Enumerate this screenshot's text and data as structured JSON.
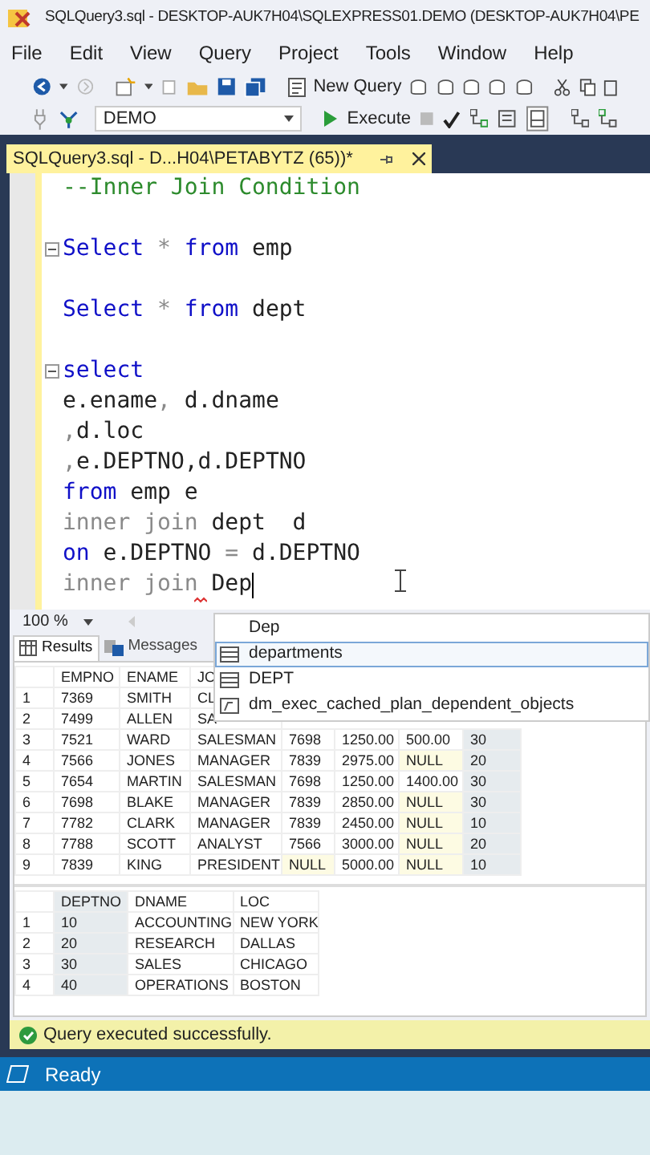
{
  "window": {
    "title": "SQLQuery3.sql - DESKTOP-AUK7H04\\SQLEXPRESS01.DEMO (DESKTOP-AUK7H04\\PE"
  },
  "menu": [
    "File",
    "Edit",
    "View",
    "Query",
    "Project",
    "Tools",
    "Window",
    "Help"
  ],
  "toolbar": {
    "new_query": "New Query",
    "database": "DEMO",
    "execute": "Execute"
  },
  "document_tab": {
    "title": "SQLQuery3.sql - D...H04\\PETABYTZ (65))*",
    "selected": true
  },
  "editor": {
    "lines": [
      {
        "fold": false,
        "tokens": [
          {
            "text": "--Inner Join Condition",
            "kind": "comment"
          }
        ]
      },
      {
        "fold": false
      },
      {
        "fold": true,
        "tokens": [
          {
            "text": "Select",
            "kind": "keyword"
          },
          {
            "text": " * ",
            "kind": "operator"
          },
          {
            "text": "from",
            "kind": "keyword"
          },
          {
            "text": " emp",
            "kind": "plain"
          }
        ]
      },
      {
        "fold": false
      },
      {
        "fold": false,
        "tokens": [
          {
            "text": "Select",
            "kind": "keyword"
          },
          {
            "text": " * ",
            "kind": "operator"
          },
          {
            "text": "from",
            "kind": "keyword"
          },
          {
            "text": " dept",
            "kind": "plain"
          }
        ]
      },
      {
        "fold": false
      },
      {
        "fold": true,
        "tokens": [
          {
            "text": "select",
            "kind": "keyword"
          }
        ]
      },
      {
        "fold": false,
        "tokens": [
          {
            "text": "e.ename",
            "kind": "plain"
          },
          {
            "text": ",",
            "kind": "operator"
          },
          {
            "text": " d.dname",
            "kind": "plain"
          }
        ]
      },
      {
        "fold": false,
        "tokens": [
          {
            "text": ",",
            "kind": "operator"
          },
          {
            "text": "d.loc",
            "kind": "plain"
          }
        ]
      },
      {
        "fold": false,
        "tokens": [
          {
            "text": ",",
            "kind": "operator"
          },
          {
            "text": "e.DEPTNO,d.DEPTNO",
            "kind": "plain"
          }
        ]
      },
      {
        "fold": false,
        "tokens": [
          {
            "text": "from",
            "kind": "keyword"
          },
          {
            "text": " emp e",
            "kind": "plain"
          }
        ]
      },
      {
        "fold": false,
        "tokens": [
          {
            "text": "inner join",
            "kind": "operator"
          },
          {
            "text": " dept  d",
            "kind": "plain"
          }
        ]
      },
      {
        "fold": false,
        "tokens": [
          {
            "text": "on",
            "kind": "keyword"
          },
          {
            "text": " e.DEPTNO ",
            "kind": "plain"
          },
          {
            "text": "=",
            "kind": "operator"
          },
          {
            "text": " d.DEPTNO",
            "kind": "plain"
          }
        ]
      },
      {
        "fold": false,
        "caret": true,
        "tokens": [
          {
            "text": "inner join",
            "kind": "operator"
          },
          {
            "text": " Dep",
            "kind": "plain"
          }
        ]
      }
    ]
  },
  "autocomplete": [
    {
      "text": "Dep",
      "kind": "typed",
      "selected": false
    },
    {
      "text": "departments",
      "kind": "table",
      "selected": true
    },
    {
      "text": "DEPT",
      "kind": "table",
      "selected": false
    },
    {
      "text": "dm_exec_cached_plan_dependent_objects",
      "kind": "function",
      "selected": false
    }
  ],
  "zoom": "100 %",
  "results_tabs": [
    {
      "label": "Results",
      "kind": "grid",
      "selected": true
    },
    {
      "label": "Messages",
      "kind": "messages",
      "selected": false
    }
  ],
  "grids": [
    {
      "columns": [
        {
          "label": "EMPNO",
          "selected": false
        },
        {
          "label": "ENAME",
          "selected": false
        },
        {
          "label": "JO",
          "selected": false
        },
        {
          "selected": false
        },
        {
          "selected": false
        },
        {
          "selected": false
        },
        {
          "selected": true
        }
      ],
      "rows": [
        {
          "number": "1",
          "cells": [
            "7369",
            "SMITH",
            "CL"
          ]
        },
        {
          "number": "2",
          "cells": [
            "7499",
            "ALLEN",
            "SA"
          ]
        },
        {
          "number": "3",
          "cells": [
            "7521",
            "WARD",
            "SALESMAN",
            "7698",
            "1250.00",
            "500.00",
            "30"
          ]
        },
        {
          "number": "4",
          "cells": [
            "7566",
            "JONES",
            "MANAGER",
            "7839",
            "2975.00",
            {
              "text": "NULL",
              "kind": "null"
            },
            "20"
          ]
        },
        {
          "number": "5",
          "cells": [
            "7654",
            "MARTIN",
            "SALESMAN",
            "7698",
            "1250.00",
            "1400.00",
            "30"
          ]
        },
        {
          "number": "6",
          "cells": [
            "7698",
            "BLAKE",
            "MANAGER",
            "7839",
            "2850.00",
            {
              "text": "NULL",
              "kind": "null"
            },
            "30"
          ]
        },
        {
          "number": "7",
          "cells": [
            "7782",
            "CLARK",
            "MANAGER",
            "7839",
            "2450.00",
            {
              "text": "NULL",
              "kind": "null"
            },
            "10"
          ]
        },
        {
          "number": "8",
          "cells": [
            "7788",
            "SCOTT",
            "ANALYST",
            "7566",
            "3000.00",
            {
              "text": "NULL",
              "kind": "null"
            },
            "20"
          ]
        },
        {
          "number": "9",
          "cells": [
            "7839",
            "KING",
            "PRESIDENT",
            {
              "text": "NULL",
              "kind": "null"
            },
            "5000.00",
            {
              "text": "NULL",
              "kind": "null"
            },
            "10"
          ]
        }
      ]
    },
    {
      "columns": [
        {
          "label": "DEPTNO",
          "selected": true
        },
        {
          "label": "DNAME",
          "selected": false
        },
        {
          "label": "LOC",
          "selected": false
        }
      ],
      "rows": [
        {
          "number": "1",
          "cells": [
            "10",
            "ACCOUNTING",
            "NEW YORK"
          ]
        },
        {
          "number": "2",
          "cells": [
            "20",
            "RESEARCH",
            "DALLAS"
          ]
        },
        {
          "number": "3",
          "cells": [
            "30",
            "SALES",
            "CHICAGO"
          ]
        },
        {
          "number": "4",
          "cells": [
            "40",
            "OPERATIONS",
            "BOSTON"
          ]
        }
      ]
    }
  ],
  "query_status": "Query executed successfully.",
  "status_bar": "Ready"
}
